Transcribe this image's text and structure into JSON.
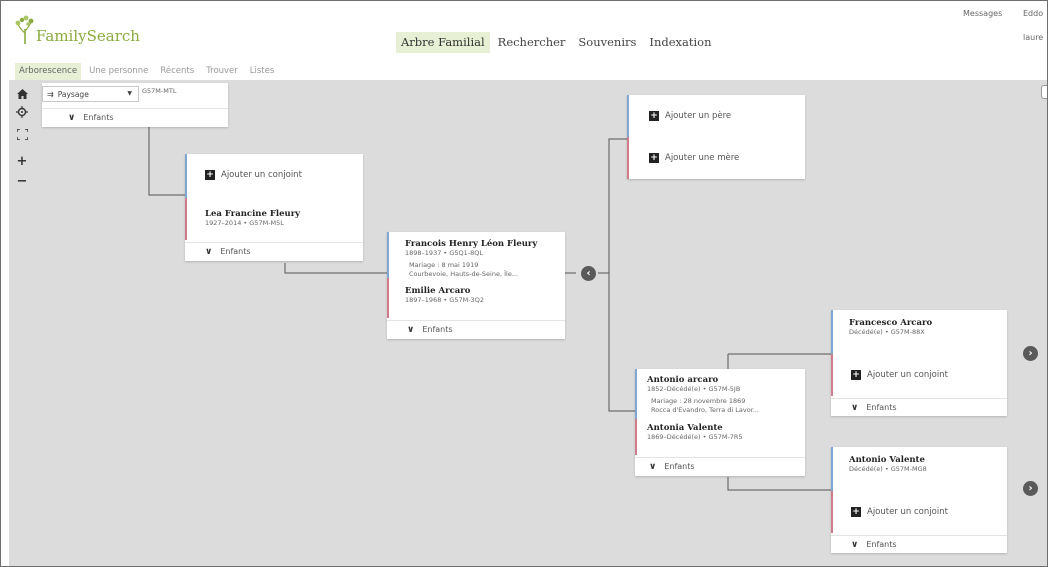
{
  "header": {
    "logo_text": "FamilySearch",
    "nav": [
      {
        "label": "Arbre Familial",
        "active": true
      },
      {
        "label": "Rechercher",
        "active": false
      },
      {
        "label": "Souvenirs",
        "active": false
      },
      {
        "label": "Indexation",
        "active": false
      }
    ],
    "messages": "Messages",
    "top_right_a": "Eddo",
    "top_right_b": "laure"
  },
  "subnav": [
    {
      "label": "Arborescence",
      "active": true
    },
    {
      "label": "Une personne",
      "active": false
    },
    {
      "label": "Récents",
      "active": false
    },
    {
      "label": "Trouver",
      "active": false
    },
    {
      "label": "Listes",
      "active": false
    }
  ],
  "toolbar": {
    "view_select": "Paysage",
    "home_icon": "home-icon",
    "locate_icon": "target-icon",
    "fit_icon": "fullscreen-icon",
    "zoom_in": "+",
    "zoom_out": "−"
  },
  "root_card": {
    "id_text": "G57M-MTL",
    "children_label": "Enfants"
  },
  "lea_card": {
    "add_spouse": "Ajouter un conjoint",
    "name": "Lea Francine Fleury",
    "meta": "1927–2014 • G57M-M5L",
    "children_label": "Enfants"
  },
  "francois_card": {
    "husband_name": "Francois Henry Léon Fleury",
    "husband_meta": "1898–1937 • G5Q1-8QL",
    "marriage_line1": "Mariage : 8 mai 1919",
    "marriage_line2": "Courbevoie, Hauts-de-Seine, Île...",
    "wife_name": "Emilie Arcaro",
    "wife_meta": "1897–1968 • G57M-3Q2",
    "children_label": "Enfants"
  },
  "parents_placeholder_card": {
    "add_father": "Ajouter un père",
    "add_mother": "Ajouter une mère"
  },
  "antonio_card": {
    "husband_name": "Antonio arcaro",
    "husband_meta": "1852–Décédé(e) • G57M-5JB",
    "marriage_line1": "Mariage : 28 novembre 1869",
    "marriage_line2": "Rocca d'Evandro, Terra di Lavor...",
    "wife_name": "Antonia Valente",
    "wife_meta": "1869–Décédé(e) • G57M-7R5",
    "children_label": "Enfants"
  },
  "francesco_card": {
    "name": "Francesco Arcaro",
    "meta": "Décédé(e) • G57M-88X",
    "add_spouse": "Ajouter un conjoint",
    "children_label": "Enfants"
  },
  "antonio_valente_card": {
    "name": "Antonio Valente",
    "meta": "Décédé(e) • G57M-MG8",
    "add_spouse": "Ajouter un conjoint",
    "children_label": "Enfants"
  },
  "colors": {
    "male_bar": "#7ea8d2",
    "female_bar": "#cf7b8b",
    "brand_green": "#8aab3f",
    "canvas_bg": "#dcdcdc",
    "active_tab_bg": "#e7efd5"
  }
}
